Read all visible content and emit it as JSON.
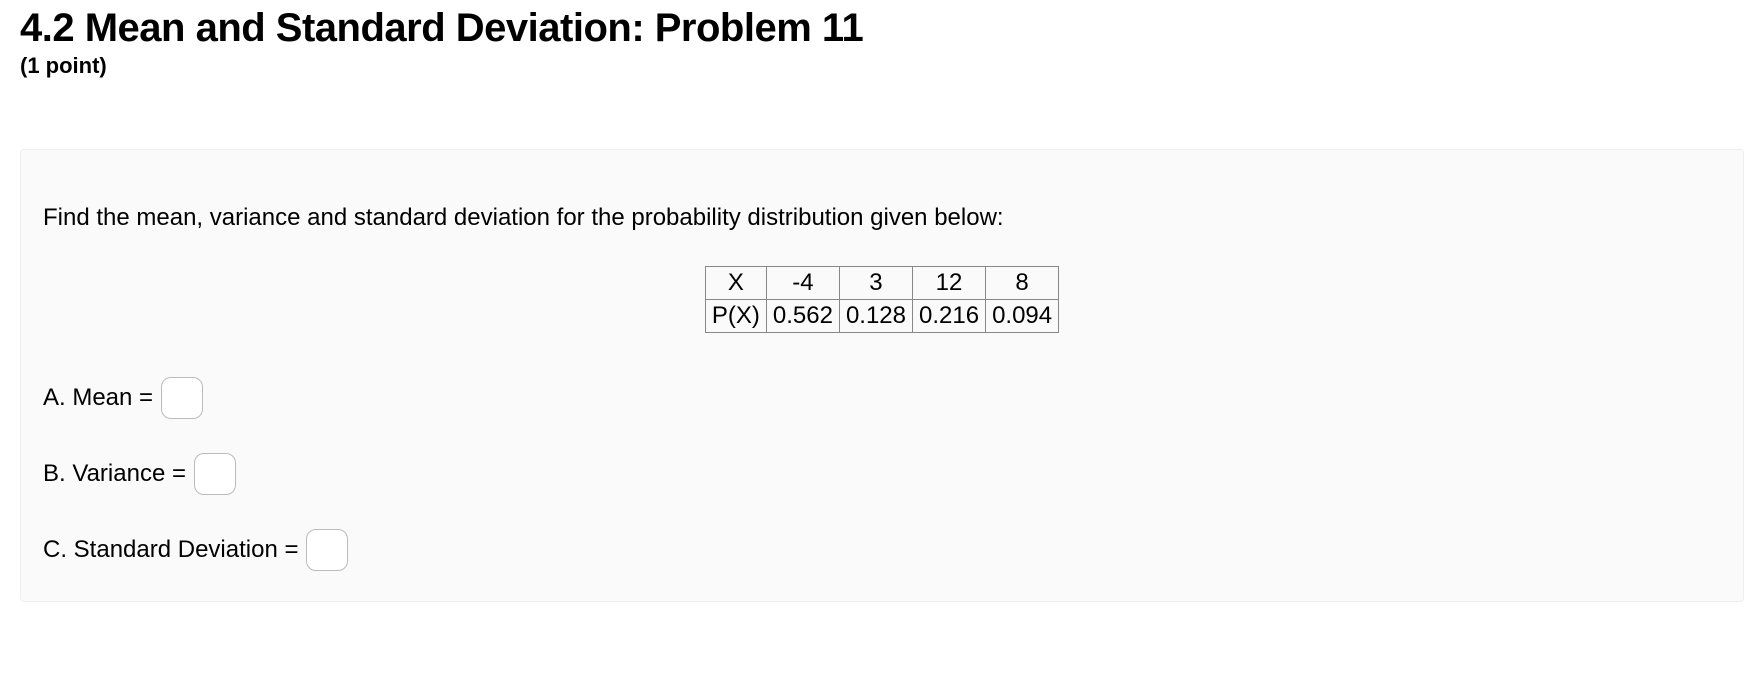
{
  "header": {
    "title": "4.2 Mean and Standard Deviation: Problem 11",
    "points": "(1 point)"
  },
  "problem": {
    "prompt": "Find the mean, variance and standard deviation for the probability distribution given below:",
    "table": {
      "row_labels": [
        "X",
        "P(X)"
      ],
      "x_values": [
        "-4",
        "3",
        "12",
        "8"
      ],
      "p_values": [
        "0.562",
        "0.128",
        "0.216",
        "0.094"
      ]
    },
    "answers": {
      "a": {
        "label": "A. Mean =",
        "value": ""
      },
      "b": {
        "label": "B. Variance =",
        "value": ""
      },
      "c": {
        "label": "C. Standard Deviation =",
        "value": ""
      }
    }
  }
}
